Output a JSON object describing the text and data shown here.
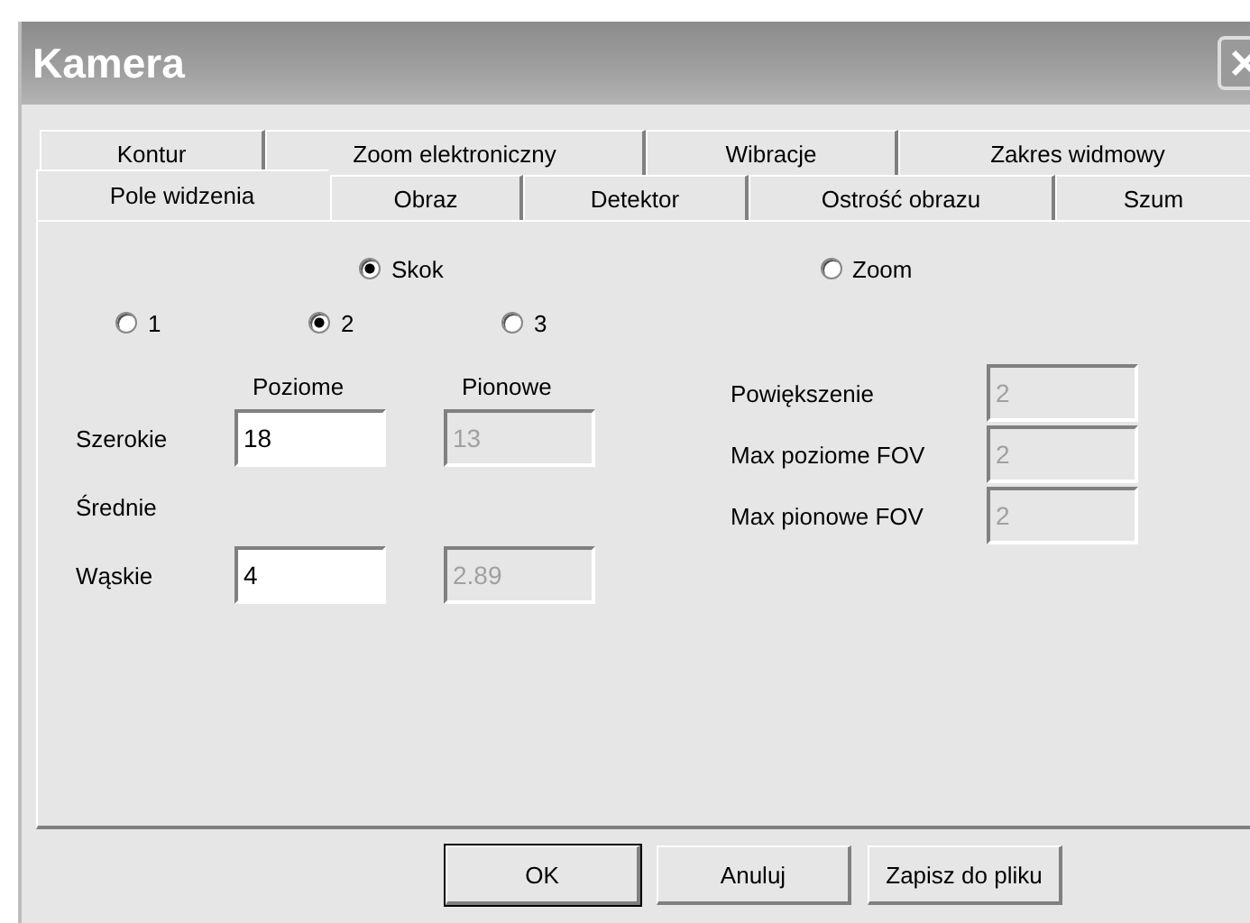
{
  "window": {
    "title": "Kamera"
  },
  "tab_rows": [
    [
      {
        "label": "Kontur",
        "selected": false
      },
      {
        "label": "Zoom elektroniczny",
        "selected": false
      },
      {
        "label": "Wibracje",
        "selected": false
      },
      {
        "label": "Zakres widmowy",
        "selected": false
      }
    ],
    [
      {
        "label": "Pole widzenia",
        "selected": true
      },
      {
        "label": "Obraz",
        "selected": false
      },
      {
        "label": "Detektor",
        "selected": false
      },
      {
        "label": "Ostrość obrazu",
        "selected": false
      },
      {
        "label": "Szum",
        "selected": false
      }
    ]
  ],
  "mode_options": [
    {
      "label": "Skok",
      "selected": true
    },
    {
      "label": "Zoom",
      "selected": false
    }
  ],
  "step_options": [
    {
      "label": "1",
      "selected": false
    },
    {
      "label": "2",
      "selected": true
    },
    {
      "label": "3",
      "selected": false
    }
  ],
  "column_headers": [
    "Poziome",
    "Pionowe"
  ],
  "rows": [
    {
      "label": "Szerokie",
      "fields": [
        {
          "value": "18",
          "disabled": false
        },
        {
          "value": "13",
          "disabled": true
        }
      ]
    },
    {
      "label": "Średnie",
      "fields": []
    },
    {
      "label": "Wąskie",
      "fields": [
        {
          "value": "4",
          "disabled": false
        },
        {
          "value": "2.89",
          "disabled": true
        }
      ]
    }
  ],
  "zoom_fields": [
    {
      "label": "Powiększenie",
      "value": "2",
      "disabled": true
    },
    {
      "label": "Max poziome FOV",
      "value": "2",
      "disabled": true
    },
    {
      "label": "Max pionowe FOV",
      "value": "2",
      "disabled": true
    }
  ],
  "buttons": [
    {
      "label": "OK",
      "default": true
    },
    {
      "label": "Anuluj",
      "default": false
    },
    {
      "label": "Zapisz do pliku",
      "default": false
    }
  ]
}
